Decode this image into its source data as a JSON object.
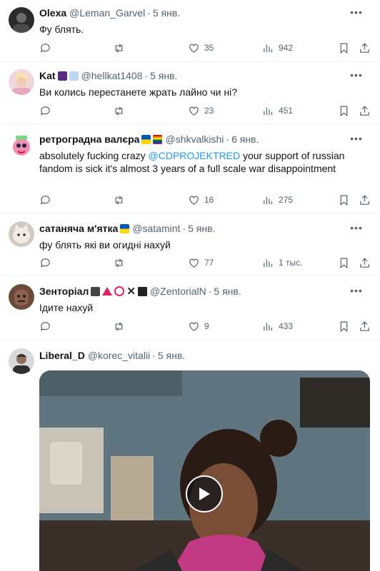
{
  "tweets": [
    {
      "name": "Olexa",
      "handle": "@Leman_Garvel",
      "dot": "·",
      "date": "5 янв.",
      "text": "Фу блять.",
      "replies": "",
      "retweets": "",
      "likes": "35",
      "views": "942",
      "avatar_color": "#2b2b2b",
      "emoji": []
    },
    {
      "name": "Kat",
      "handle": "@hellkat1408",
      "dot": "·",
      "date": "5 янв.",
      "text": "Ви колись перестанете жрать лайно чи ні?",
      "replies": "",
      "retweets": "",
      "likes": "23",
      "views": "451",
      "avatar_color": "#e8b9c8",
      "emoji": [
        "#5b2a86",
        "#b9d9f5"
      ]
    },
    {
      "name": "ретроградна валєра",
      "handle": "@shkvalkishi",
      "dot": "·",
      "date": "6 янв.",
      "text_before": "absolutely fucking crazy ",
      "mention": "@CDPROJEKTRED",
      "text_after": " your support of russian fandom is sick it's almost 3 years of a full scale war disappointment",
      "replies": "",
      "retweets": "",
      "likes": "16",
      "views": "275",
      "avatar_color": "#f5a3c7",
      "emoji": [
        "#ffd500",
        "#e04b6f"
      ]
    },
    {
      "name": "сатаняча м'ятка",
      "handle": "@satamint",
      "dot": "·",
      "date": "5 янв.",
      "text": "фу блять які ви огидні нахуй",
      "replies": "",
      "retweets": "",
      "likes": "77",
      "views": "1 тыс.",
      "avatar_color": "#b9b3aa",
      "emoji": [
        "#ffd500"
      ]
    },
    {
      "name": "Зенторіал",
      "handle": "@ZentorialN",
      "dot": "·",
      "date": "5 янв.",
      "text": "Ідите нахуй",
      "replies": "",
      "retweets": "",
      "likes": "9",
      "views": "433",
      "avatar_color": "#6b4a3a",
      "emoji": [
        "#444444",
        "#e0245e",
        "#e0245e",
        "#222222",
        "#222222"
      ]
    },
    {
      "name": "Liberal_D",
      "handle": "@korec_vitalii",
      "dot": "·",
      "date": "5 янв.",
      "avatar_color": "#3a3a3a",
      "emoji": []
    }
  ],
  "icons": {
    "reply": "reply-icon",
    "retweet": "retweet-icon",
    "like": "heart-icon",
    "views": "views-icon",
    "bookmark": "bookmark-icon",
    "share": "share-icon",
    "more": "more-icon",
    "play": "play-icon"
  },
  "colors": {
    "text": "#0f1419",
    "muted": "#536471",
    "link": "#1d9bf0",
    "border": "#eff3f4"
  }
}
